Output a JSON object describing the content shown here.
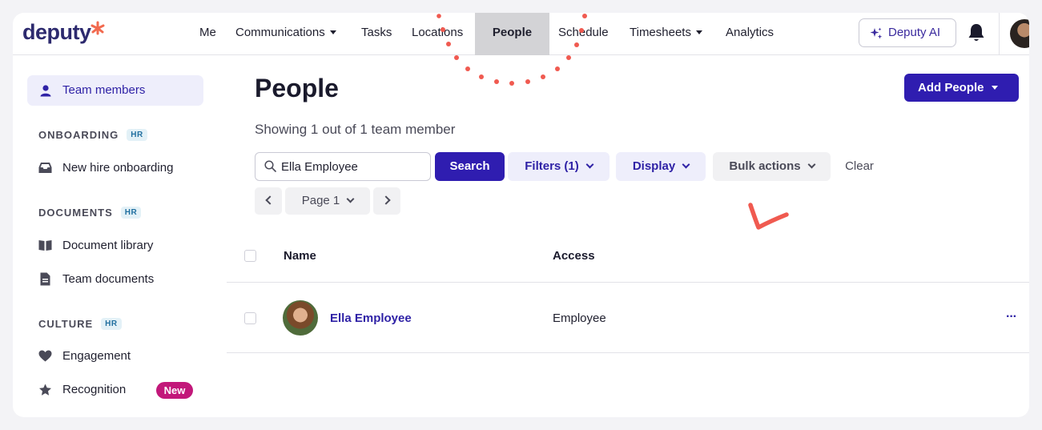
{
  "nav": {
    "logo": "deputy",
    "items": [
      "Me",
      "Communications",
      "Tasks",
      "Locations",
      "People",
      "Schedule",
      "Timesheets",
      "Analytics"
    ],
    "active": "People",
    "ai_label": "Deputy AI"
  },
  "sidebar": {
    "team_members": "Team members",
    "onboarding_heading": "ONBOARDING",
    "new_hire": "New hire onboarding",
    "documents_heading": "DOCUMENTS",
    "document_library": "Document library",
    "team_documents": "Team documents",
    "culture_heading": "CULTURE",
    "engagement": "Engagement",
    "recognition": "Recognition",
    "hr_badge": "HR",
    "new_badge": "New"
  },
  "main": {
    "title": "People",
    "add_people": "Add People",
    "showing": "Showing 1 out of 1 team member",
    "search_value": "Ella Employee",
    "search_button": "Search",
    "filters": "Filters (1)",
    "display": "Display",
    "bulk_actions": "Bulk actions",
    "clear": "Clear",
    "page": "Page 1"
  },
  "table": {
    "headers": {
      "name": "Name",
      "access": "Access"
    },
    "rows": [
      {
        "name": "Ella Employee",
        "access": "Employee",
        "more": "···"
      }
    ]
  },
  "colors": {
    "primary": "#2f1db0",
    "annotation": "#f05a50",
    "new_badge": "#c2187a"
  }
}
